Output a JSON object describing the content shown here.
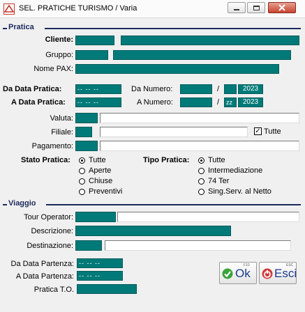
{
  "window": {
    "title": "SEL. PRATICHE TURISMO / Varia",
    "icon": "app-icon",
    "controls": {
      "minimize": "minimize-icon",
      "maximize": "maximize-icon",
      "close": "close-icon"
    }
  },
  "pratica": {
    "group_title": "Pratica",
    "cliente_label": "Cliente:",
    "gruppo_label": "Gruppo:",
    "nome_pax_label": "Nome PAX:",
    "da_data_label": "Da Data Pratica:",
    "a_data_label": "A  Data Pratica:",
    "da_data_value": "-- -- --",
    "a_data_value": "-- -- --",
    "da_numero_label": "Da Numero:",
    "a_numero_label": "A  Numero:",
    "slash": "/",
    "da_numero_suffix": "",
    "a_numero_suffix": "zz",
    "da_year": "2023",
    "a_year": "2023",
    "valuta_label": "Valuta:",
    "filiale_label": "Filiale:",
    "pagamento_label": "Pagamento:",
    "tutte_check_label": "Tutte",
    "tutte_checked": true
  },
  "stato_pratica": {
    "label": "Stato Pratica:",
    "options": [
      "Tutte",
      "Aperte",
      "Chiuse",
      "Preventivi"
    ],
    "selected": "Tutte"
  },
  "tipo_pratica": {
    "label": "Tipo Pratica:",
    "options": [
      "Tutte",
      "Intermediazione",
      "74 Ter",
      "Sing.Serv. al Netto"
    ],
    "selected": "Tutte"
  },
  "viaggio": {
    "group_title": "Viaggio",
    "tour_operator_label": "Tour Operator:",
    "descrizione_label": "Descrizione:",
    "destinazione_label": "Destinazione:",
    "da_data_partenza_label": "Da Data Partenza:",
    "a_data_partenza_label": "A Data Partenza:",
    "pratica_to_label": "Pratica T.O.",
    "da_data_partenza_value": "-- -- --",
    "a_data_partenza_value": "-- -- --"
  },
  "buttons": {
    "ok": {
      "label": "Ok",
      "key": "F10",
      "icon": "checkmark-icon"
    },
    "esci": {
      "label": "Esci",
      "key": "ESC",
      "icon": "exit-icon"
    }
  },
  "colors": {
    "field_teal": "#007a78",
    "group_header": "#1c2a5c",
    "background": "#f0f0f0"
  }
}
